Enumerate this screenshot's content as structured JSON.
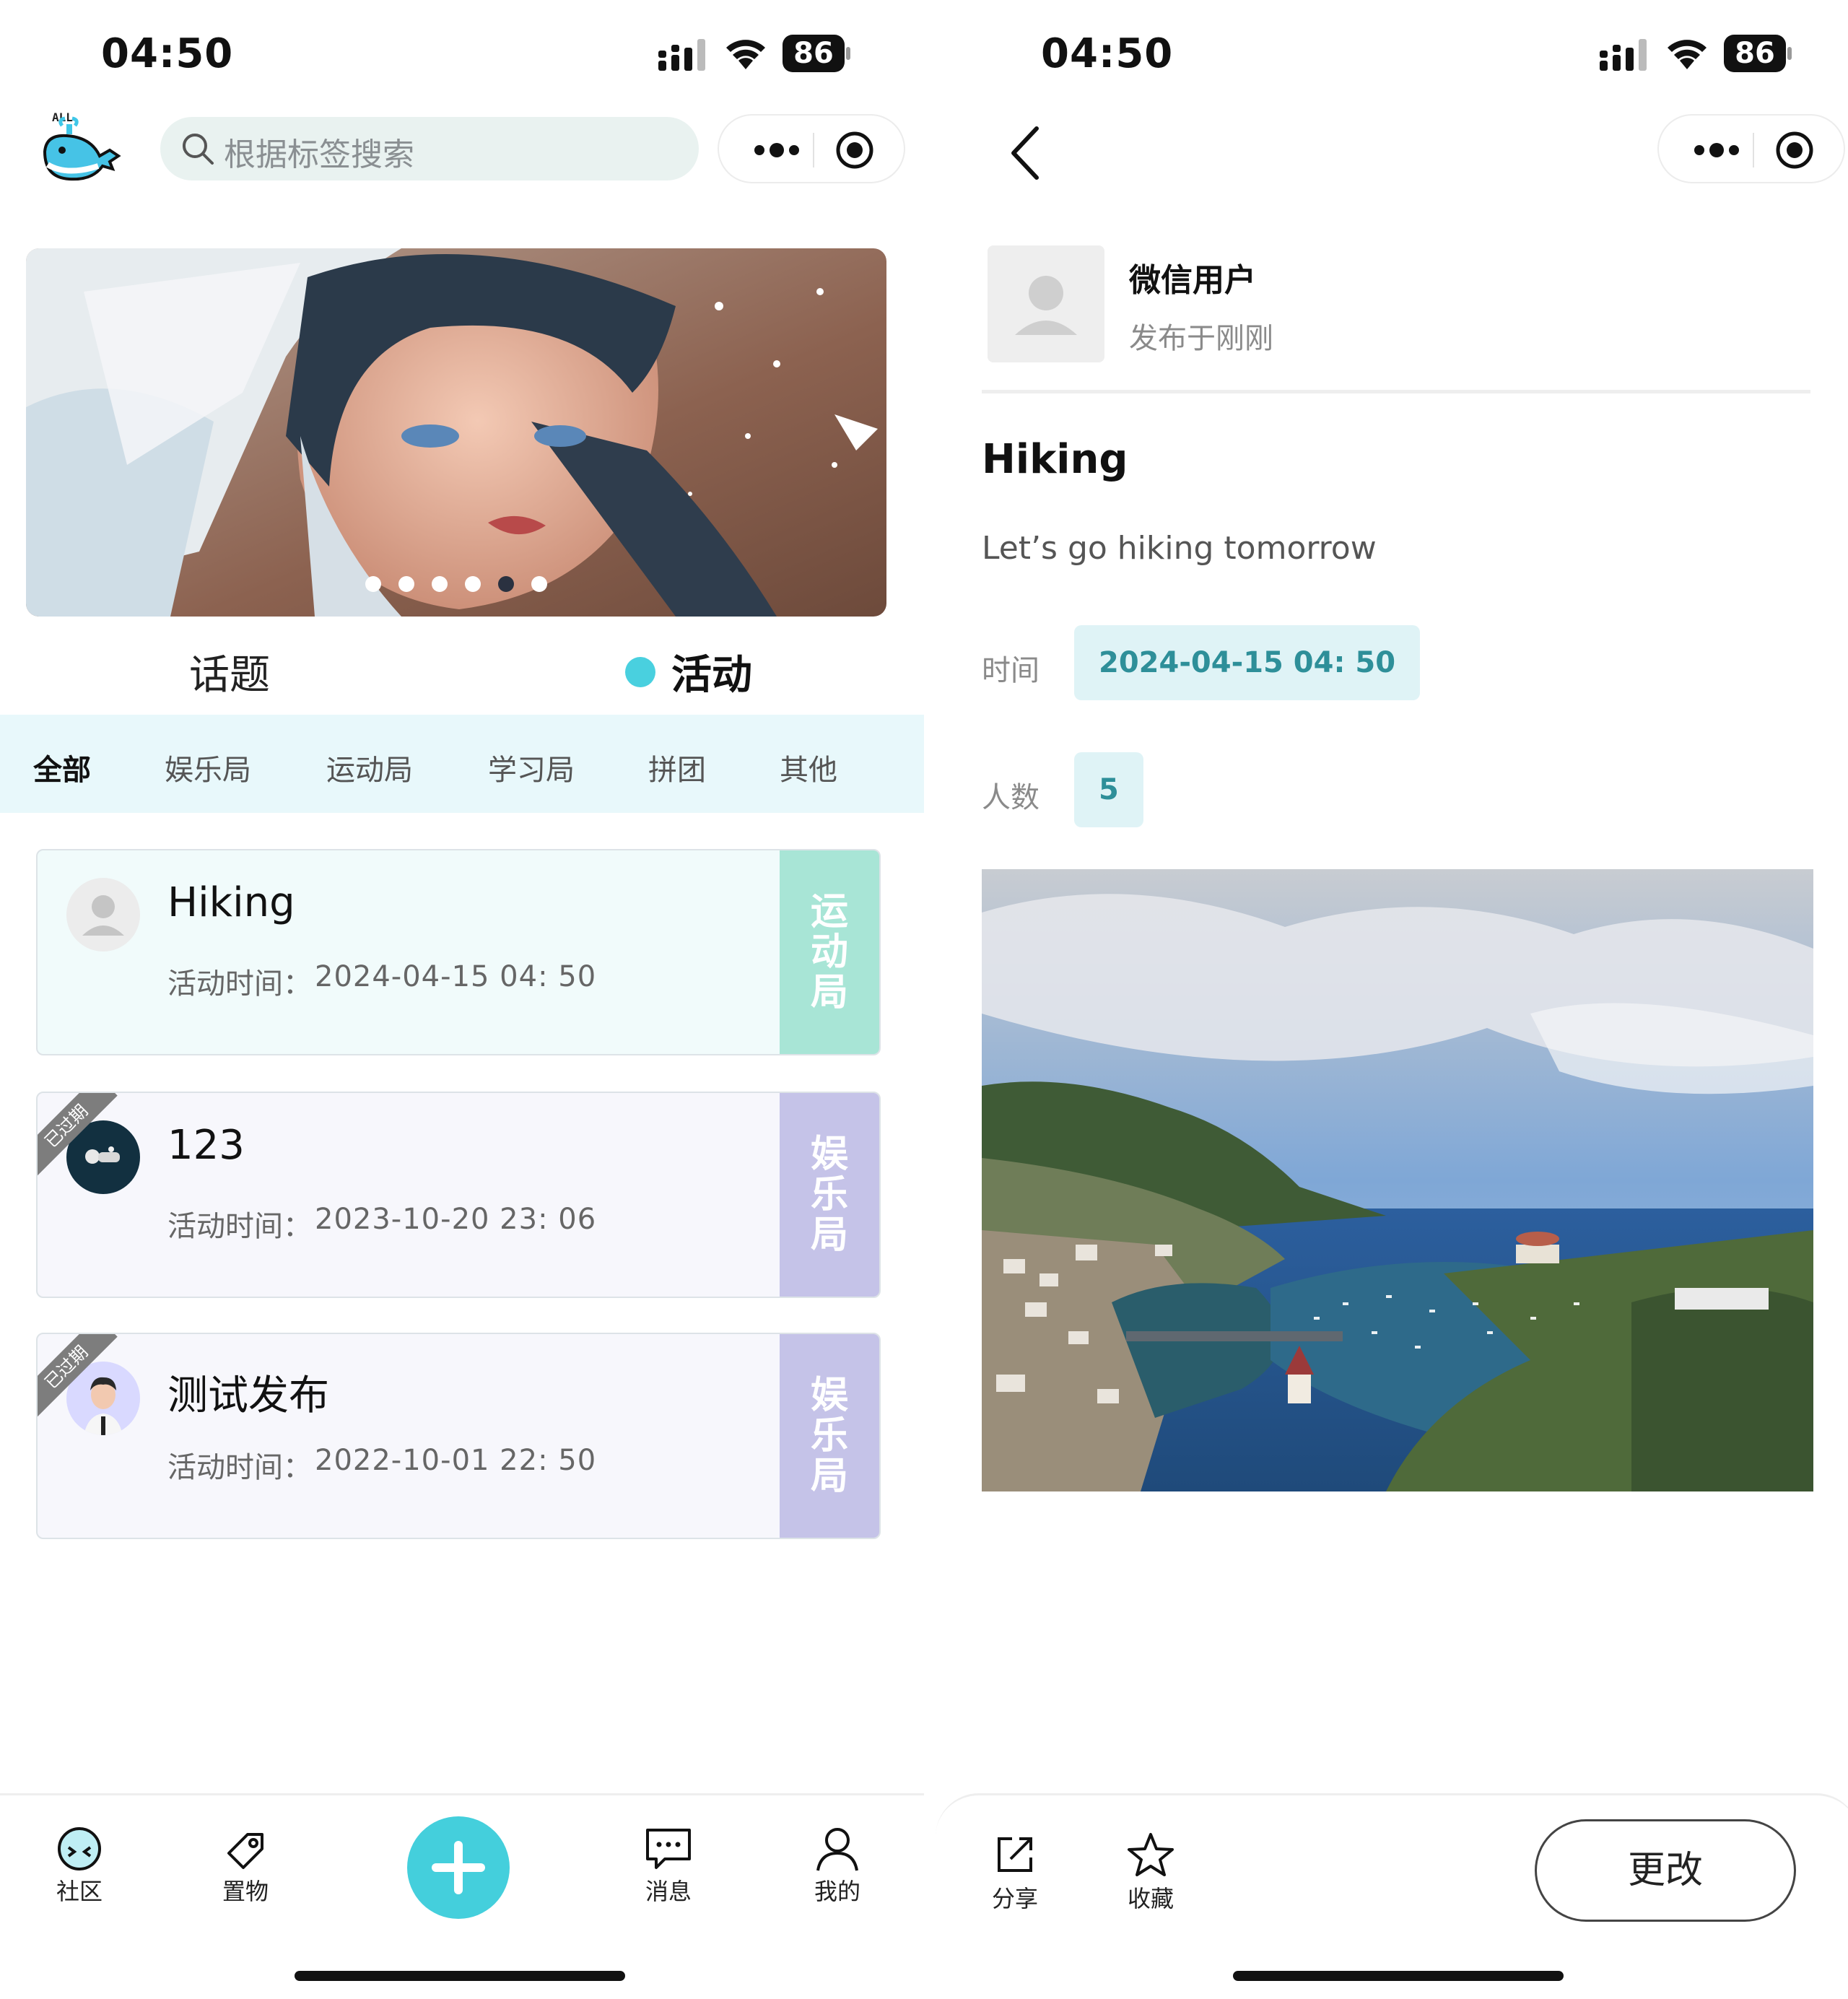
{
  "status": {
    "time": "04:50",
    "battery": "86"
  },
  "left": {
    "search": {
      "placeholder": "根据标签搜索"
    },
    "banner": {
      "dot_count": 6,
      "active_dot": 5
    },
    "main_tabs": [
      {
        "label": "话题",
        "active": false
      },
      {
        "label": "活动",
        "active": true
      }
    ],
    "sub_tabs": [
      {
        "label": "全部",
        "active": true
      },
      {
        "label": "娱乐局",
        "active": false
      },
      {
        "label": "运动局",
        "active": false
      },
      {
        "label": "学习局",
        "active": false
      },
      {
        "label": "拼团",
        "active": false
      },
      {
        "label": "其他",
        "active": false
      }
    ],
    "time_label": "活动时间：",
    "cards": [
      {
        "title": "Hiking",
        "time": "2024-04-15 04: 50",
        "category": "运动局",
        "expired": false,
        "bg": "#f1fbfb",
        "side_color": "#a8e5d6"
      },
      {
        "title": "123",
        "time": "2023-10-20 23: 06",
        "category": "娱乐局",
        "expired": true,
        "expired_label": "已过期",
        "bg": "#f7f7fc",
        "side_color": "#c5c3e8"
      },
      {
        "title": "测试发布",
        "time": "2022-10-01 22: 50",
        "category": "娱乐局",
        "expired": true,
        "expired_label": "已过期",
        "bg": "#f7f7fc",
        "side_color": "#c5c3e8"
      }
    ],
    "tabbar": [
      {
        "label": "社区",
        "icon": "community-icon"
      },
      {
        "label": "置物",
        "icon": "tag-icon"
      },
      {
        "label": "",
        "icon": "plus-icon"
      },
      {
        "label": "消息",
        "icon": "message-icon"
      },
      {
        "label": "我的",
        "icon": "profile-icon"
      }
    ]
  },
  "right": {
    "user_name": "微信用户",
    "post_time": "发布于刚刚",
    "title": "Hiking",
    "body": "Let’s go hiking tomorrow",
    "time_label": "时间",
    "time_value": "2024-04-15 04: 50",
    "people_label": "人数",
    "people_value": "5",
    "actions": {
      "share": "分享",
      "favorite": "收藏",
      "edit": "更改"
    }
  },
  "colors": {
    "accent": "#44cfdc",
    "sport": "#a8e5d6",
    "entertainment": "#c5c3e8",
    "expired_ribbon": "#7d7d7d"
  }
}
